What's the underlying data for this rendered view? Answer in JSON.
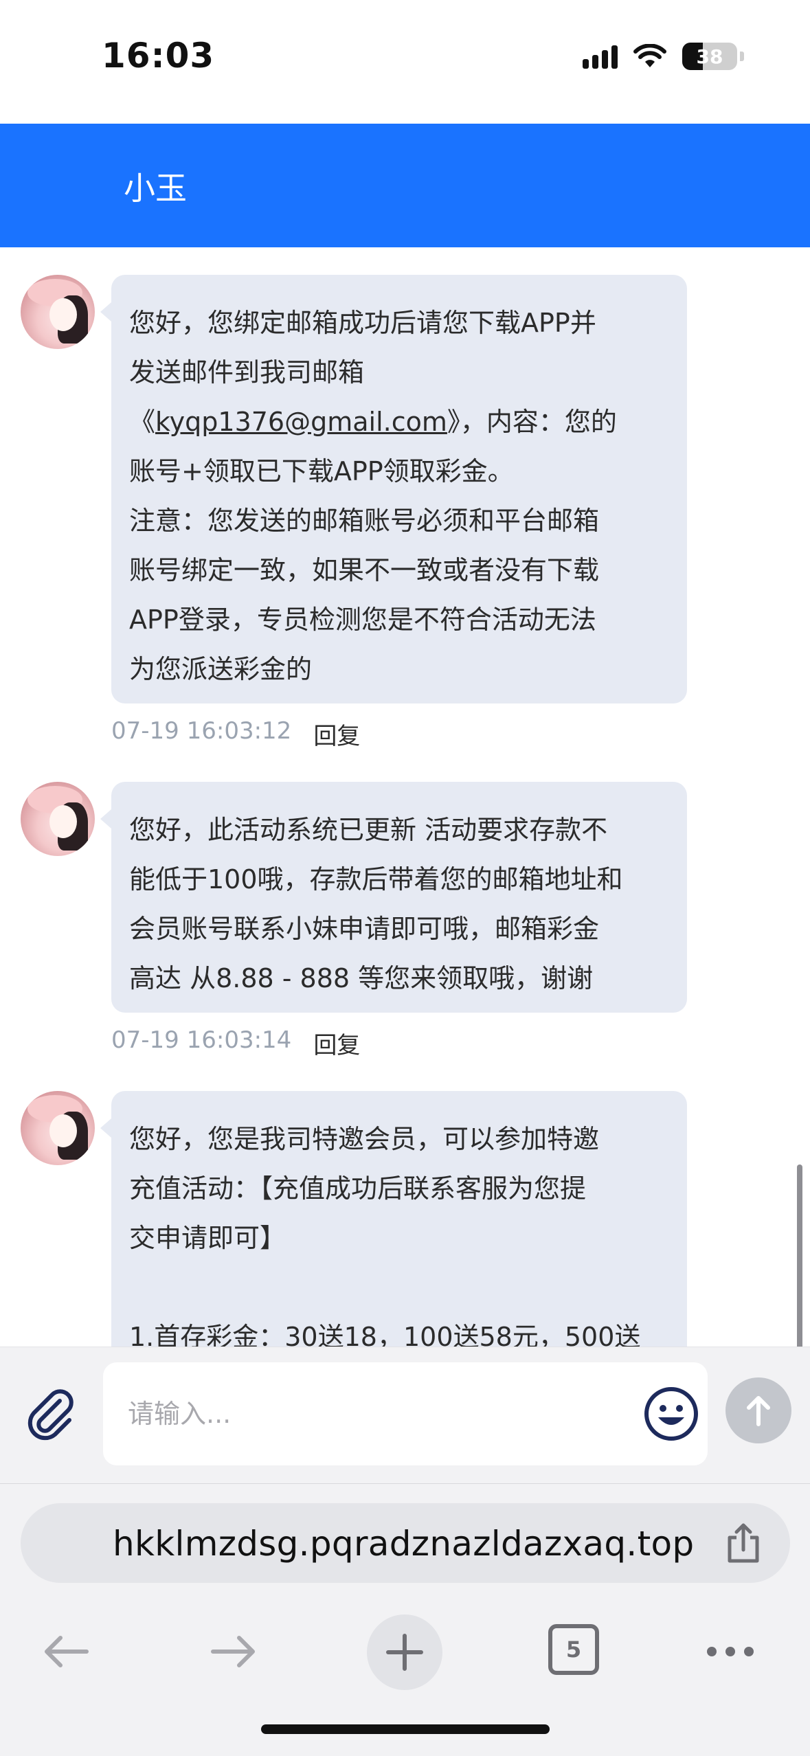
{
  "status_bar": {
    "time": "16:03",
    "battery": "38",
    "icons": [
      "signal-icon",
      "wifi-icon",
      "battery-icon"
    ]
  },
  "header": {
    "title": "小玉",
    "color": "#1a73ff"
  },
  "messages": [
    {
      "line1": "您好，您绑定邮箱成功后请您下载APP并",
      "line2": "发送邮件到我司邮箱",
      "line3_prefix": "《",
      "email": "kyqp1376@gmail.com",
      "line3_suffix": "》，内容：您的",
      "line4": "账号+领取已下载APP领取彩金。",
      "line5": "注意：您发送的邮箱账号必须和平台邮箱",
      "line6": "账号绑定一致，如果不一致或者没有下载",
      "line7": "APP登录，专员检测您是不符合活动无法",
      "line8": "为您派送彩金的",
      "time": "07-19 16:03:12",
      "reply": "回复"
    },
    {
      "text": "您好，此活动系统已更新 活动要求存款不\n能低于100哦，存款后带着您的邮箱地址和\n会员账号联系小妹申请即可哦，邮箱彩金\n高达 从8.88 - 888 等您来领取哦，谢谢",
      "time": "07-19 16:03:14",
      "reply": "回复"
    },
    {
      "text": "您好，您是我司特邀会员，可以参加特邀\n充值活动：【充值成功后联系客服为您提\n交申请即可】\n\n1.首存彩金：30送18，100送58元，500送"
    }
  ],
  "input": {
    "placeholder": "请输入..."
  },
  "browser": {
    "url": "hkklmzdsg.pqradznazldazxaq.top",
    "tab_count": "5"
  },
  "colors": {
    "bubble": "#e6eaf3",
    "timestamp": "#9aa3b0"
  }
}
